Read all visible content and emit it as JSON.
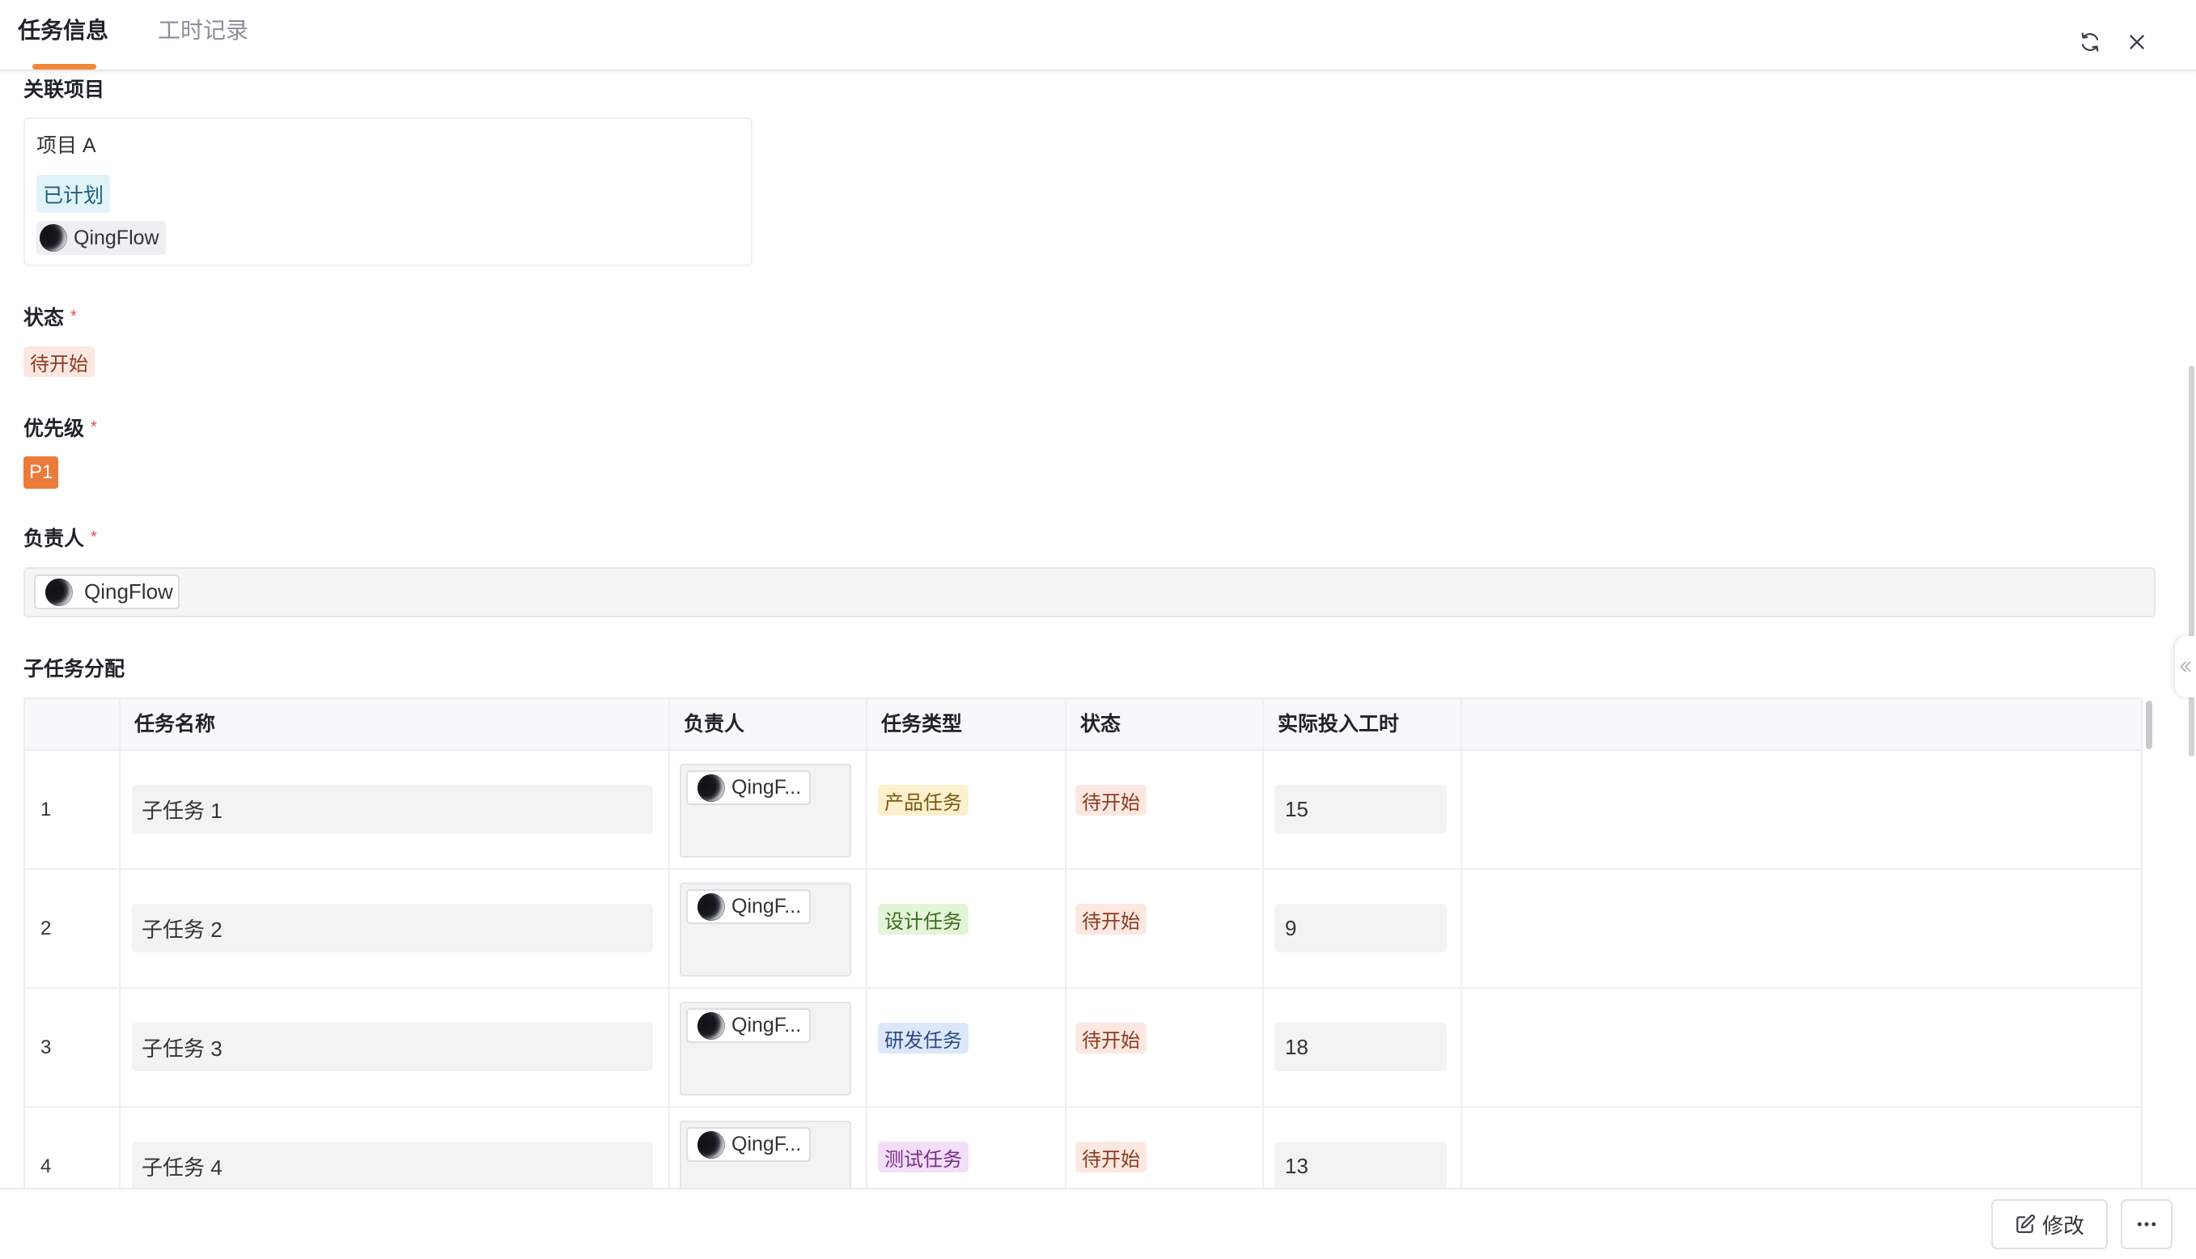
{
  "colors": {
    "accent": "#f0883a",
    "required": "#e5484d"
  },
  "tabs": [
    {
      "label": "任务信息"
    },
    {
      "label": "工时记录"
    }
  ],
  "header": {
    "refresh_icon": "refresh-icon",
    "close_icon": "close-icon"
  },
  "related_project": {
    "label": "关联项目",
    "name": "项目 A",
    "status": {
      "text": "已计划",
      "bg": "#dff3f9",
      "fg": "#1e5e79"
    },
    "owner": "QingFlow"
  },
  "status_field": {
    "label": "状态",
    "required_mark": "*",
    "value": {
      "text": "待开始",
      "bg": "#fce8e1",
      "fg": "#8c3a1e"
    }
  },
  "priority_field": {
    "label": "优先级",
    "required_mark": "*",
    "value": {
      "text": "P1",
      "bg": "#ec7a3a",
      "fg": "#ffffff"
    }
  },
  "assignee_field": {
    "label": "负责人",
    "required_mark": "*",
    "value": "QingFlow"
  },
  "subtasks": {
    "label": "子任务分配",
    "columns": [
      "任务名称",
      "负责人",
      "任务类型",
      "状态",
      "实际投入工时"
    ],
    "rows": [
      {
        "index": "1",
        "name": "子任务 1",
        "assignee": "QingF...",
        "type": {
          "text": "产品任务",
          "bg": "#fdf0cc",
          "fg": "#7a5713"
        },
        "status": {
          "text": "待开始",
          "bg": "#fce8e1",
          "fg": "#8c3a1e"
        },
        "hours": "15"
      },
      {
        "index": "2",
        "name": "子任务 2",
        "assignee": "QingF...",
        "type": {
          "text": "设计任务",
          "bg": "#e2f5d8",
          "fg": "#3b6a1e"
        },
        "status": {
          "text": "待开始",
          "bg": "#fce8e1",
          "fg": "#8c3a1e"
        },
        "hours": "9"
      },
      {
        "index": "3",
        "name": "子任务 3",
        "assignee": "QingF...",
        "type": {
          "text": "研发任务",
          "bg": "#dce7fa",
          "fg": "#2b4a86"
        },
        "status": {
          "text": "待开始",
          "bg": "#fce8e1",
          "fg": "#8c3a1e"
        },
        "hours": "18"
      },
      {
        "index": "4",
        "name": "子任务 4",
        "assignee": "QingF...",
        "type": {
          "text": "测试任务",
          "bg": "#f2dff7",
          "fg": "#7b2b8b"
        },
        "status": {
          "text": "待开始",
          "bg": "#fce8e1",
          "fg": "#8c3a1e"
        },
        "hours": "13"
      }
    ]
  },
  "side": {
    "collapse_icon": "double-chevron-left-icon"
  },
  "footer": {
    "edit_label": "修改",
    "edit_icon": "edit-icon",
    "more_icon": "more-horizontal-icon"
  }
}
